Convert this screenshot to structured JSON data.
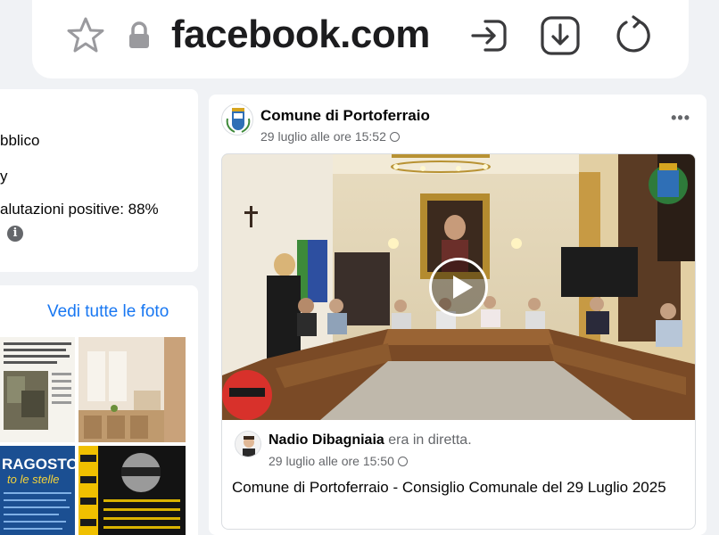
{
  "browser": {
    "url": "facebook.com",
    "icons": [
      "star-icon",
      "lock-icon",
      "share-icon",
      "download-icon",
      "reload-icon"
    ]
  },
  "left_panel": {
    "info_lines": [
      "bblico",
      "y",
      "alutazioni positive: 88%"
    ],
    "info_icon_glyph": "i",
    "see_all_photos": "Vedi tutte le foto"
  },
  "post": {
    "page_name": "Comune di Portoferraio",
    "time": "29 luglio alle ore 15:52",
    "more_glyph": "•••",
    "shared": {
      "author": "Nadio Dibagniaia",
      "action": "era in diretta.",
      "time": "29 luglio alle ore 15:50",
      "text": "Comune di Portoferraio - Consiglio Comunale del 29 Luglio 2025"
    }
  },
  "colors": {
    "link": "#1877f2",
    "secondary_text": "#65676b",
    "background": "#f0f2f5"
  }
}
